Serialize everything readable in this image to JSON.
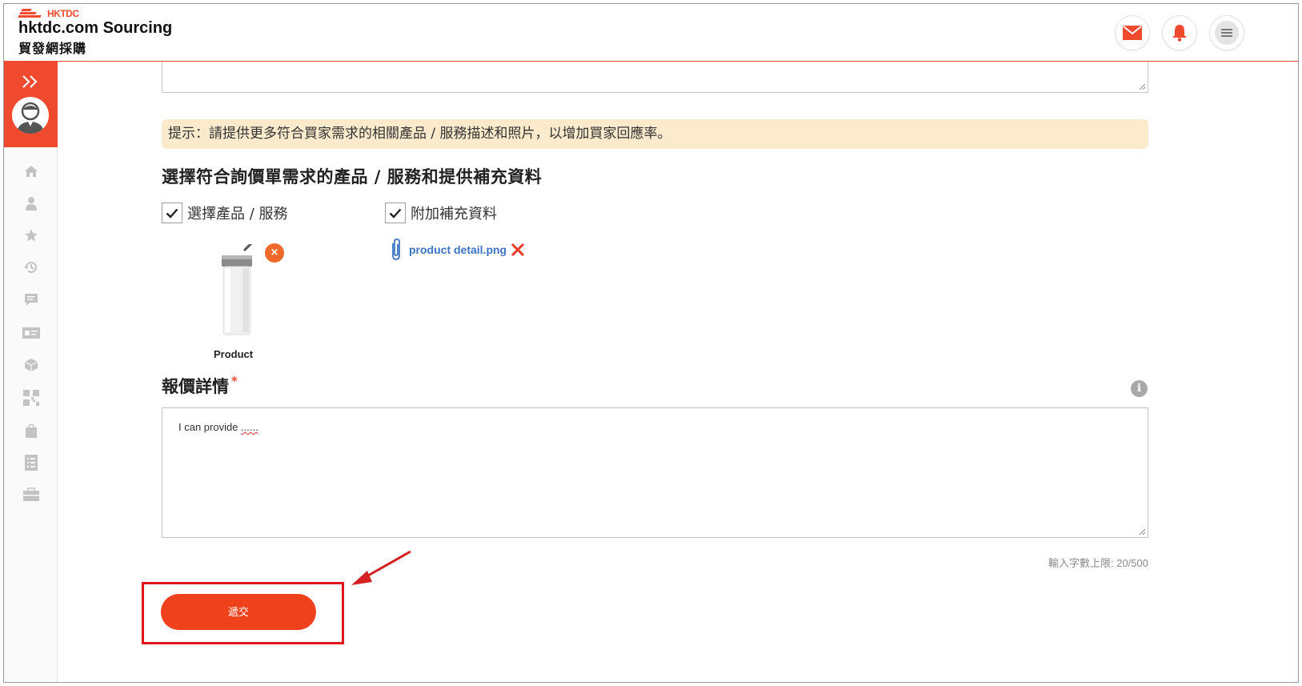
{
  "header": {
    "logo_mark": "HKTDC",
    "brand_en": "hktdc.com Sourcing",
    "brand_zh": "貿發網採購",
    "buttons": [
      {
        "name": "messages",
        "icon": "mail-icon"
      },
      {
        "name": "notifications",
        "icon": "bell-icon"
      },
      {
        "name": "menu",
        "icon": "hamburger-menu-icon"
      }
    ]
  },
  "sidebar": {
    "expand_icon": "double-chevron-right-icon",
    "items": [
      {
        "icon": "home-icon"
      },
      {
        "icon": "user-icon"
      },
      {
        "icon": "star-icon"
      },
      {
        "icon": "history-icon"
      },
      {
        "icon": "message-icon"
      },
      {
        "icon": "id-card-icon"
      },
      {
        "icon": "box-icon"
      },
      {
        "icon": "qr-code-icon"
      },
      {
        "icon": "shopping-bag-icon"
      },
      {
        "icon": "list-icon"
      },
      {
        "icon": "briefcase-icon"
      }
    ]
  },
  "form": {
    "hint": "提示：請提供更多符合買家需求的相關產品 / 服務描述和照片，以增加買家回應率。",
    "section_title": "選擇符合詢價單需求的產品 / 服務和提供補充資料",
    "select_products_label": "選擇產品 / 服務",
    "select_products_checked": true,
    "attach_info_label": "附加補充資料",
    "attach_info_checked": true,
    "product": {
      "name": "Product",
      "remove_symbol": "×"
    },
    "attachment": {
      "filename": "product detail.png"
    },
    "quote_title": "報價詳情",
    "required_mark": "*",
    "info_symbol": "i",
    "quote_text_prefix": "I can provide ",
    "quote_text_suffix": "......",
    "char_count": "輸入字數上限: 20/500",
    "submit_label": "遞交"
  },
  "colors": {
    "brand": "#ef4a2e",
    "hint_bg": "#fbeacc",
    "submit": "#f0411d",
    "link": "#3b74c4",
    "annotation": "#e0141a"
  }
}
